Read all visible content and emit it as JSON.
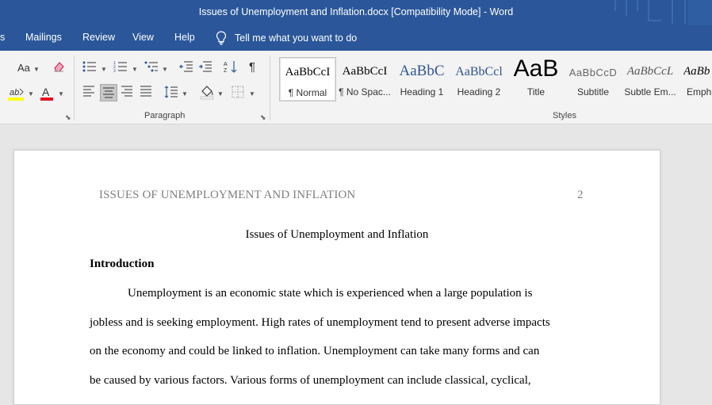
{
  "window": {
    "title": "Issues of Unemployment and Inflation.docx [Compatibility Mode]  -  Word"
  },
  "tabs": {
    "partial": "s",
    "mailings": "Mailings",
    "review": "Review",
    "view": "View",
    "help": "Help",
    "tell_me": "Tell me what you want to do"
  },
  "ribbon": {
    "font_case_label": "Aa",
    "paragraph_label": "Paragraph",
    "styles_label": "Styles",
    "pilcrow": "¶",
    "styles": [
      {
        "preview": "AaBbCcI",
        "name": "¶ Normal"
      },
      {
        "preview": "AaBbCcI",
        "name": "¶ No Spac..."
      },
      {
        "preview": "AaBbC",
        "name": "Heading 1"
      },
      {
        "preview": "AaBbCcl",
        "name": "Heading 2"
      },
      {
        "preview": "AaB",
        "name": "Title"
      },
      {
        "preview": "AaBbCcD",
        "name": "Subtitle"
      },
      {
        "preview": "AaBbCcL",
        "name": "Subtle Em..."
      },
      {
        "preview": "AaBb",
        "name": "Emph"
      }
    ]
  },
  "colors": {
    "word_blue": "#2b579a",
    "highlight": "#ffff00",
    "font_color": "#e81123"
  },
  "document": {
    "header_text": "ISSUES OF UNEMPLOYMENT AND INFLATION",
    "page_number": "2",
    "title": "Issues of Unemployment and Inflation",
    "heading": "Introduction",
    "lines": [
      "Unemployment is an economic state which is experienced when a large population is",
      "jobless and is seeking employment. High rates of unemployment tend to present adverse impacts",
      "on the economy and could be linked to inflation. Unemployment can take many forms and can",
      "be caused by various factors. Various forms of unemployment can include classical, cyclical,"
    ]
  }
}
